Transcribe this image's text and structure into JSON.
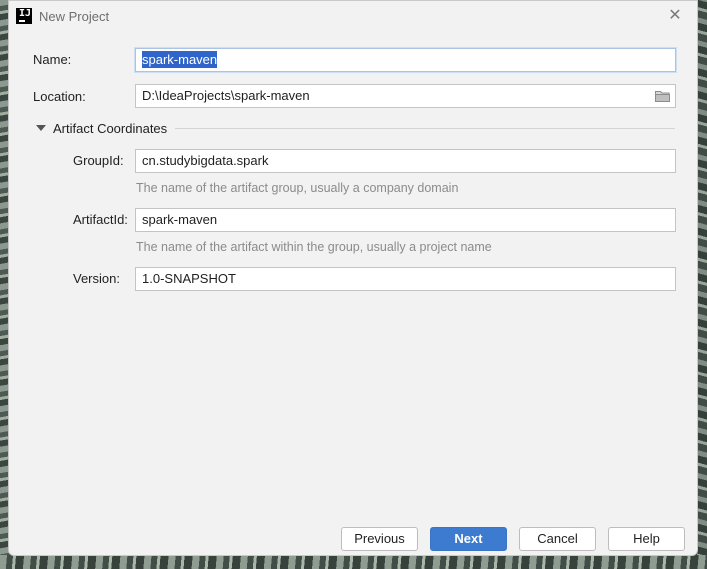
{
  "window": {
    "title": "New Project",
    "close_glyph": "✕"
  },
  "form": {
    "name_label": "Name:",
    "name_value": "spark-maven",
    "location_label": "Location:",
    "location_value": "D:\\IdeaProjects\\spark-maven",
    "location_browse_icon": "folder-icon"
  },
  "artifact": {
    "section_title": "Artifact Coordinates",
    "expanded": true,
    "groupid_label": "GroupId:",
    "groupid_value": "cn.studybigdata.spark",
    "groupid_hint": "The name of the artifact group, usually a company domain",
    "artifactid_label": "ArtifactId:",
    "artifactid_value": "spark-maven",
    "artifactid_hint": "The name of the artifact within the group, usually a project name",
    "version_label": "Version:",
    "version_value": "1.0-SNAPSHOT"
  },
  "buttons": {
    "previous": "Previous",
    "next": "Next",
    "cancel": "Cancel",
    "help": "Help"
  },
  "colors": {
    "primary_button": "#3d7bd0",
    "selection": "#2f65ca",
    "dialog_bg": "#f2f2f2",
    "hint_text": "#8b8b8b"
  }
}
